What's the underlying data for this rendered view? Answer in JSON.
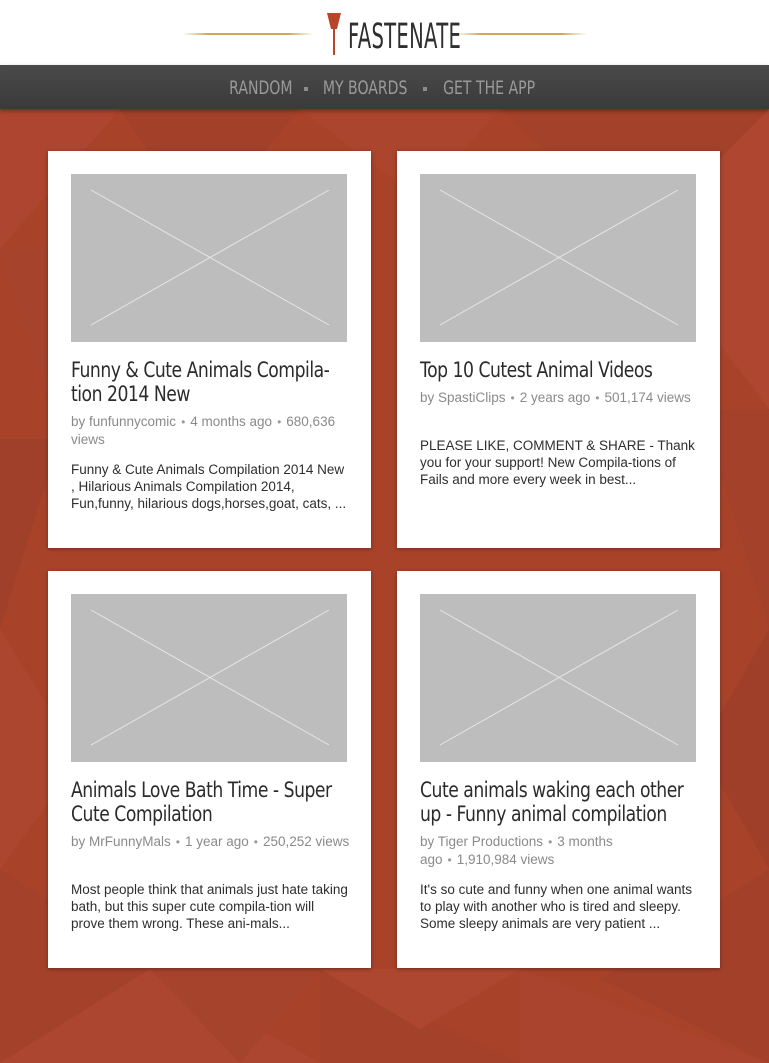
{
  "brand": {
    "name": "FASTENATE",
    "accent": "#b8452a"
  },
  "nav": {
    "items": [
      {
        "label": "RANDOM"
      },
      {
        "label": "MY BOARDS"
      },
      {
        "label": "GET THE APP"
      }
    ]
  },
  "colors": {
    "page_background": "#a8432a",
    "nav_background": "#3f3f3f",
    "card_background": "#ffffff",
    "thumbnail_placeholder": "#bdbdbd"
  },
  "cards": [
    {
      "title": "Funny & Cute Animals Compila-tion 2014 New",
      "author": "by funfunnycomic",
      "age": "4 months ago",
      "views": "680,636 views",
      "description": "Funny & Cute Animals Compilation 2014 New , Hilarious Animals Compilation 2014, Fun,funny, hilarious dogs,horses,goat, cats, ..."
    },
    {
      "title": "Top 10 Cutest Animal Videos",
      "author": "by SpastiClips",
      "age": "2 years ago",
      "views": "501,174 views",
      "description": "PLEASE LIKE, COMMENT & SHARE - Thank you for your support! New Compila-tions of Fails and more every week in best..."
    },
    {
      "title": "Animals Love Bath Time - Super Cute Compilation",
      "author": "by MrFunnyMals",
      "age": "1 year ago",
      "views": "250,252 views",
      "description": "Most people think that animals just hate taking bath, but this super cute compila-tion will prove them wrong. These ani-mals..."
    },
    {
      "title": "Cute animals waking each other up - Funny animal compilation",
      "author": "by Tiger Productions",
      "age": "3 months ago",
      "views": "1,910,984 views",
      "description": "It's so cute and funny when one animal wants to play with another who is tired and sleepy. Some sleepy animals are very patient ..."
    }
  ]
}
